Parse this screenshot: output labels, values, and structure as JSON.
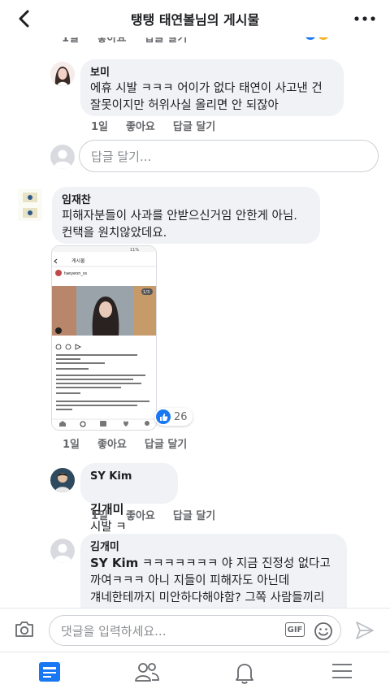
{
  "header": {
    "title": "탱탱 태연볼님의 게시물"
  },
  "top_actions": {
    "time": "1일",
    "like": "좋아요",
    "reply": "답글 달기"
  },
  "comments": [
    {
      "name": "보미",
      "text": "에휴 시발 ㅋㅋㅋ 어이가 없다 태연이 사고낸 건\n잘못이지만 허위사실 올리면 안 되잖아",
      "time": "1일",
      "like": "좋아요",
      "reply": "답글 달기"
    },
    {
      "name": "임재찬",
      "text": "피해자분들이 사과를 안받으신거임 안한게 아님.\n컨택을 원치않았데요.",
      "time": "1일",
      "like": "좋아요",
      "reply": "답글 달기",
      "reaction_count": "26"
    },
    {
      "name": "SY Kim",
      "mention": "김개미",
      "text": "시발 ㅋ",
      "time": "1일",
      "like": "좋아요",
      "reply": "답글 달기"
    },
    {
      "name": "김개미",
      "mention": "SY Kim",
      "text": "ㅋㅋㅋㅋㅋㅋㅋ 야 지금 진정성 없다고\n까여ㅋㅋㅋ 아니 지들이 피해자도 아닌데\n걔네한테까지 미안하다해야함? 그쪽 사람들끼리\n알아서 하겠지"
    }
  ],
  "reply_box": {
    "placeholder": "답글 달기..."
  },
  "embedded_shot": {
    "title": "게시물",
    "user": "taeyeon_ss",
    "page_indicator": "1/3",
    "status": "11%"
  },
  "composer": {
    "placeholder": "댓글을 입력하세요...",
    "gif_label": "GIF"
  },
  "colors": {
    "accent": "#1877f2",
    "bubble": "#f0f2f5",
    "meta": "#65676b"
  }
}
